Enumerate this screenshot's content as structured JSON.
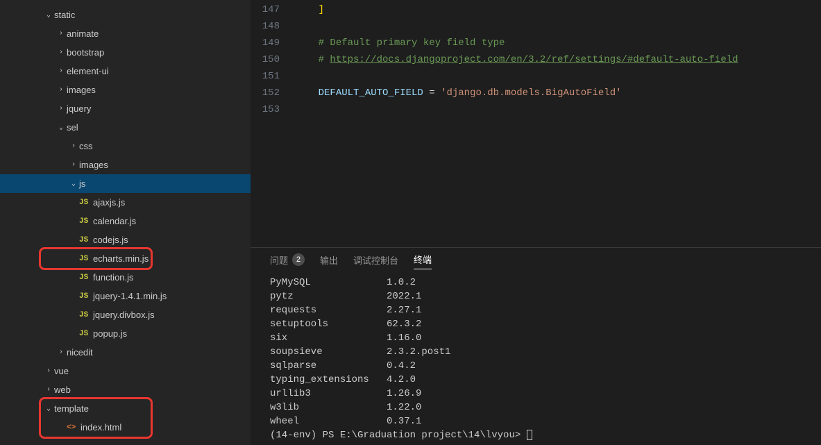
{
  "sidebar": {
    "tree": [
      {
        "indent": 62,
        "chev": "v",
        "label": "static",
        "icon": "",
        "iconClass": ""
      },
      {
        "indent": 80,
        "chev": ">",
        "label": "animate",
        "icon": "",
        "iconClass": ""
      },
      {
        "indent": 80,
        "chev": ">",
        "label": "bootstrap",
        "icon": "",
        "iconClass": ""
      },
      {
        "indent": 80,
        "chev": ">",
        "label": "element-ui",
        "icon": "",
        "iconClass": ""
      },
      {
        "indent": 80,
        "chev": ">",
        "label": "images",
        "icon": "",
        "iconClass": ""
      },
      {
        "indent": 80,
        "chev": ">",
        "label": "jquery",
        "icon": "",
        "iconClass": ""
      },
      {
        "indent": 80,
        "chev": "v",
        "label": "sel",
        "icon": "",
        "iconClass": ""
      },
      {
        "indent": 98,
        "chev": ">",
        "label": "css",
        "icon": "",
        "iconClass": ""
      },
      {
        "indent": 98,
        "chev": ">",
        "label": "images",
        "icon": "",
        "iconClass": ""
      },
      {
        "indent": 98,
        "chev": "v",
        "label": "js",
        "icon": "",
        "iconClass": "",
        "selected": true
      },
      {
        "indent": 98,
        "chev": "",
        "label": "ajaxjs.js",
        "icon": "JS",
        "iconClass": "js"
      },
      {
        "indent": 98,
        "chev": "",
        "label": "calendar.js",
        "icon": "JS",
        "iconClass": "js"
      },
      {
        "indent": 98,
        "chev": "",
        "label": "codejs.js",
        "icon": "JS",
        "iconClass": "js"
      },
      {
        "indent": 98,
        "chev": "",
        "label": "echarts.min.js",
        "icon": "JS",
        "iconClass": "js",
        "boxed": 1
      },
      {
        "indent": 98,
        "chev": "",
        "label": "function.js",
        "icon": "JS",
        "iconClass": "js"
      },
      {
        "indent": 98,
        "chev": "",
        "label": "jquery-1.4.1.min.js",
        "icon": "JS",
        "iconClass": "js"
      },
      {
        "indent": 98,
        "chev": "",
        "label": "jquery.divbox.js",
        "icon": "JS",
        "iconClass": "js"
      },
      {
        "indent": 98,
        "chev": "",
        "label": "popup.js",
        "icon": "JS",
        "iconClass": "js"
      },
      {
        "indent": 80,
        "chev": ">",
        "label": "nicedit",
        "icon": "",
        "iconClass": ""
      },
      {
        "indent": 62,
        "chev": ">",
        "label": "vue",
        "icon": "",
        "iconClass": ""
      },
      {
        "indent": 62,
        "chev": ">",
        "label": "web",
        "icon": "",
        "iconClass": ""
      },
      {
        "indent": 62,
        "chev": "v",
        "label": "template",
        "icon": "",
        "iconClass": "",
        "boxed": 2
      },
      {
        "indent": 80,
        "chev": "",
        "label": "index.html",
        "icon": "<>",
        "iconClass": "html",
        "boxed": 2
      }
    ]
  },
  "editor": {
    "lines": [
      {
        "num": "147",
        "tokens": [
          {
            "t": "    ",
            "c": ""
          },
          {
            "t": "]",
            "c": "tok-bracket"
          }
        ]
      },
      {
        "num": "148",
        "tokens": []
      },
      {
        "num": "149",
        "tokens": [
          {
            "t": "    ",
            "c": ""
          },
          {
            "t": "# Default primary key field type",
            "c": "tok-comment"
          }
        ]
      },
      {
        "num": "150",
        "tokens": [
          {
            "t": "    ",
            "c": ""
          },
          {
            "t": "# ",
            "c": "tok-comment"
          },
          {
            "t": "https://docs.djangoproject.com/en/3.2/ref/settings/#default-auto-field",
            "c": "tok-link"
          }
        ]
      },
      {
        "num": "151",
        "tokens": []
      },
      {
        "num": "152",
        "tokens": [
          {
            "t": "    ",
            "c": ""
          },
          {
            "t": "DEFAULT_AUTO_FIELD",
            "c": "tok-var"
          },
          {
            "t": " = ",
            "c": "tok-op"
          },
          {
            "t": "'django.db.models.BigAutoField'",
            "c": "tok-str"
          }
        ]
      },
      {
        "num": "153",
        "tokens": []
      }
    ]
  },
  "panel": {
    "tabs": [
      {
        "label": "问题",
        "badge": "2"
      },
      {
        "label": "输出"
      },
      {
        "label": "调试控制台"
      },
      {
        "label": "终端",
        "active": true
      }
    ],
    "terminal": {
      "packages": [
        {
          "name": "PyMySQL",
          "ver": "1.0.2"
        },
        {
          "name": "pytz",
          "ver": "2022.1"
        },
        {
          "name": "requests",
          "ver": "2.27.1"
        },
        {
          "name": "setuptools",
          "ver": "62.3.2"
        },
        {
          "name": "six",
          "ver": "1.16.0"
        },
        {
          "name": "soupsieve",
          "ver": "2.3.2.post1"
        },
        {
          "name": "sqlparse",
          "ver": "0.4.2"
        },
        {
          "name": "typing_extensions",
          "ver": "4.2.0"
        },
        {
          "name": "urllib3",
          "ver": "1.26.9"
        },
        {
          "name": "w3lib",
          "ver": "1.22.0"
        },
        {
          "name": "wheel",
          "ver": "0.37.1"
        }
      ],
      "prompt": "(14-env) PS E:\\Graduation project\\14\\lvyou> "
    }
  }
}
